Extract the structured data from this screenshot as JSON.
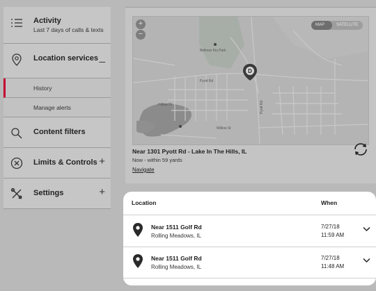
{
  "sidebar": {
    "activity": {
      "title": "Activity",
      "subtitle": "Last 7 days of calls & texts",
      "icon": "list-icon"
    },
    "location": {
      "title": "Location services",
      "toggle": "_",
      "icon": "location-pin-icon",
      "subitems": [
        {
          "label": "History",
          "active": true
        },
        {
          "label": "Manage alerts",
          "active": false
        }
      ]
    },
    "content": {
      "title": "Content filters",
      "icon": "search-icon"
    },
    "limits": {
      "title": "Limits & Controls",
      "toggle": "+",
      "icon": "block-icon"
    },
    "settings": {
      "title": "Settings",
      "toggle": "+",
      "icon": "tools-icon"
    }
  },
  "map": {
    "zoom_in": "+",
    "zoom_out": "−",
    "toggle": {
      "map": "MAP",
      "satellite": "SATELLITE",
      "selected": "MAP"
    },
    "marker_letter": "D",
    "streets": [
      "Hilltop Dr",
      "Pyott Rd",
      "Willow St",
      "Bellows Kiu Park",
      "Pyott Rd"
    ]
  },
  "current_location": {
    "title": "Near 1301 Pyott Rd - Lake In The Hills, IL",
    "subtitle": "Now - within 59 yards",
    "navigate": "Navigate"
  },
  "history": {
    "col_location": "Location",
    "col_when": "When",
    "rows": [
      {
        "address": "Near 1511 Golf Rd",
        "city": "Rolling Meadows, IL",
        "date": "7/27/18",
        "time": "11:59 AM"
      },
      {
        "address": "Near 1511 Golf Rd",
        "city": "Rolling Meadows, IL",
        "date": "7/27/18",
        "time": "11:48 AM"
      }
    ]
  },
  "colors": {
    "accent": "#c3002f",
    "overlay": "#b9b9b9",
    "card": "#ffffff"
  }
}
